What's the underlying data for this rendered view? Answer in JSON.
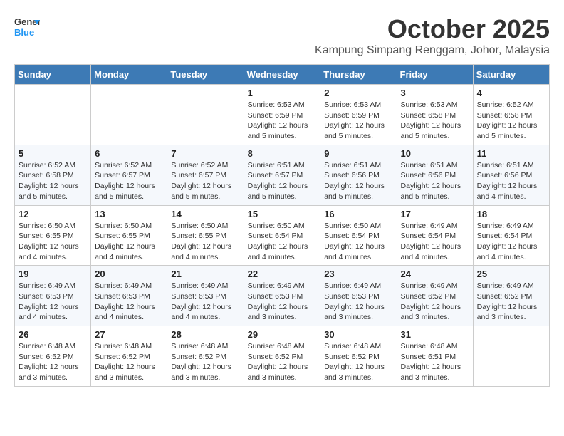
{
  "logo": {
    "line1": "General",
    "line2": "Blue"
  },
  "title": "October 2025",
  "subtitle": "Kampung Simpang Renggam, Johor, Malaysia",
  "days_of_week": [
    "Sunday",
    "Monday",
    "Tuesday",
    "Wednesday",
    "Thursday",
    "Friday",
    "Saturday"
  ],
  "weeks": [
    [
      {
        "day": "",
        "info": ""
      },
      {
        "day": "",
        "info": ""
      },
      {
        "day": "",
        "info": ""
      },
      {
        "day": "1",
        "info": "Sunrise: 6:53 AM\nSunset: 6:59 PM\nDaylight: 12 hours\nand 5 minutes."
      },
      {
        "day": "2",
        "info": "Sunrise: 6:53 AM\nSunset: 6:59 PM\nDaylight: 12 hours\nand 5 minutes."
      },
      {
        "day": "3",
        "info": "Sunrise: 6:53 AM\nSunset: 6:58 PM\nDaylight: 12 hours\nand 5 minutes."
      },
      {
        "day": "4",
        "info": "Sunrise: 6:52 AM\nSunset: 6:58 PM\nDaylight: 12 hours\nand 5 minutes."
      }
    ],
    [
      {
        "day": "5",
        "info": "Sunrise: 6:52 AM\nSunset: 6:58 PM\nDaylight: 12 hours\nand 5 minutes."
      },
      {
        "day": "6",
        "info": "Sunrise: 6:52 AM\nSunset: 6:57 PM\nDaylight: 12 hours\nand 5 minutes."
      },
      {
        "day": "7",
        "info": "Sunrise: 6:52 AM\nSunset: 6:57 PM\nDaylight: 12 hours\nand 5 minutes."
      },
      {
        "day": "8",
        "info": "Sunrise: 6:51 AM\nSunset: 6:57 PM\nDaylight: 12 hours\nand 5 minutes."
      },
      {
        "day": "9",
        "info": "Sunrise: 6:51 AM\nSunset: 6:56 PM\nDaylight: 12 hours\nand 5 minutes."
      },
      {
        "day": "10",
        "info": "Sunrise: 6:51 AM\nSunset: 6:56 PM\nDaylight: 12 hours\nand 5 minutes."
      },
      {
        "day": "11",
        "info": "Sunrise: 6:51 AM\nSunset: 6:56 PM\nDaylight: 12 hours\nand 4 minutes."
      }
    ],
    [
      {
        "day": "12",
        "info": "Sunrise: 6:50 AM\nSunset: 6:55 PM\nDaylight: 12 hours\nand 4 minutes."
      },
      {
        "day": "13",
        "info": "Sunrise: 6:50 AM\nSunset: 6:55 PM\nDaylight: 12 hours\nand 4 minutes."
      },
      {
        "day": "14",
        "info": "Sunrise: 6:50 AM\nSunset: 6:55 PM\nDaylight: 12 hours\nand 4 minutes."
      },
      {
        "day": "15",
        "info": "Sunrise: 6:50 AM\nSunset: 6:54 PM\nDaylight: 12 hours\nand 4 minutes."
      },
      {
        "day": "16",
        "info": "Sunrise: 6:50 AM\nSunset: 6:54 PM\nDaylight: 12 hours\nand 4 minutes."
      },
      {
        "day": "17",
        "info": "Sunrise: 6:49 AM\nSunset: 6:54 PM\nDaylight: 12 hours\nand 4 minutes."
      },
      {
        "day": "18",
        "info": "Sunrise: 6:49 AM\nSunset: 6:54 PM\nDaylight: 12 hours\nand 4 minutes."
      }
    ],
    [
      {
        "day": "19",
        "info": "Sunrise: 6:49 AM\nSunset: 6:53 PM\nDaylight: 12 hours\nand 4 minutes."
      },
      {
        "day": "20",
        "info": "Sunrise: 6:49 AM\nSunset: 6:53 PM\nDaylight: 12 hours\nand 4 minutes."
      },
      {
        "day": "21",
        "info": "Sunrise: 6:49 AM\nSunset: 6:53 PM\nDaylight: 12 hours\nand 4 minutes."
      },
      {
        "day": "22",
        "info": "Sunrise: 6:49 AM\nSunset: 6:53 PM\nDaylight: 12 hours\nand 3 minutes."
      },
      {
        "day": "23",
        "info": "Sunrise: 6:49 AM\nSunset: 6:53 PM\nDaylight: 12 hours\nand 3 minutes."
      },
      {
        "day": "24",
        "info": "Sunrise: 6:49 AM\nSunset: 6:52 PM\nDaylight: 12 hours\nand 3 minutes."
      },
      {
        "day": "25",
        "info": "Sunrise: 6:49 AM\nSunset: 6:52 PM\nDaylight: 12 hours\nand 3 minutes."
      }
    ],
    [
      {
        "day": "26",
        "info": "Sunrise: 6:48 AM\nSunset: 6:52 PM\nDaylight: 12 hours\nand 3 minutes."
      },
      {
        "day": "27",
        "info": "Sunrise: 6:48 AM\nSunset: 6:52 PM\nDaylight: 12 hours\nand 3 minutes."
      },
      {
        "day": "28",
        "info": "Sunrise: 6:48 AM\nSunset: 6:52 PM\nDaylight: 12 hours\nand 3 minutes."
      },
      {
        "day": "29",
        "info": "Sunrise: 6:48 AM\nSunset: 6:52 PM\nDaylight: 12 hours\nand 3 minutes."
      },
      {
        "day": "30",
        "info": "Sunrise: 6:48 AM\nSunset: 6:52 PM\nDaylight: 12 hours\nand 3 minutes."
      },
      {
        "day": "31",
        "info": "Sunrise: 6:48 AM\nSunset: 6:51 PM\nDaylight: 12 hours\nand 3 minutes."
      },
      {
        "day": "",
        "info": ""
      }
    ]
  ]
}
